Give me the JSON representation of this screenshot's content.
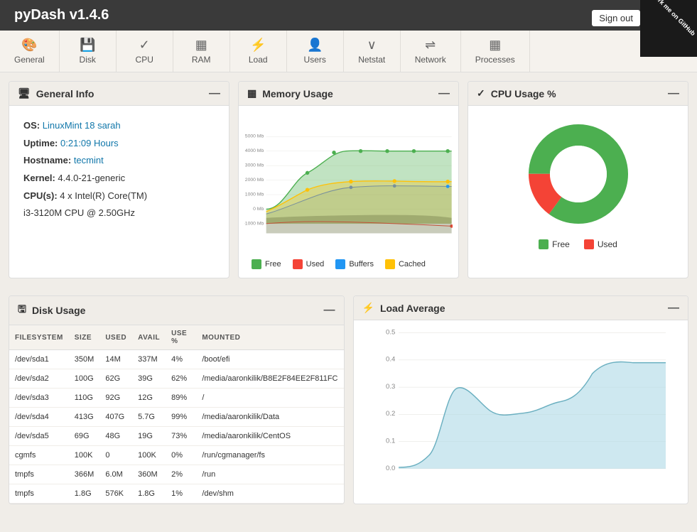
{
  "app": {
    "title": "pyDash v1.4.6",
    "sign_out_label": "Sign out",
    "github_label": "Fork me on GitHub"
  },
  "nav": {
    "items": [
      {
        "id": "general",
        "label": "General",
        "icon": "🎨"
      },
      {
        "id": "disk",
        "label": "Disk",
        "icon": "💾"
      },
      {
        "id": "cpu",
        "label": "CPU",
        "icon": "✓"
      },
      {
        "id": "ram",
        "label": "RAM",
        "icon": "▦"
      },
      {
        "id": "load",
        "label": "Load",
        "icon": "⚡"
      },
      {
        "id": "users",
        "label": "Users",
        "icon": "👤"
      },
      {
        "id": "netstat",
        "label": "Netstat",
        "icon": "∨"
      },
      {
        "id": "network",
        "label": "Network",
        "icon": "⇌"
      },
      {
        "id": "processes",
        "label": "Processes",
        "icon": "▦"
      }
    ]
  },
  "general_info": {
    "title": "General Info",
    "os_label": "OS:",
    "os_value": "LinuxMint 18 sarah",
    "uptime_label": "Uptime:",
    "uptime_value": "0:21:09 Hours",
    "hostname_label": "Hostname:",
    "hostname_value": "tecmint",
    "kernel_label": "Kernel:",
    "kernel_value": "4.4.0-21-generic",
    "cpu_label": "CPU(s):",
    "cpu_value": "4 x Intel(R) Core(TM)",
    "cpu_model": "i3-3120M CPU @ 2.50GHz"
  },
  "cpu_usage": {
    "title": "CPU Usage %",
    "free_pct": 85,
    "used_pct": 15,
    "free_label": "Free",
    "used_label": "Used",
    "free_color": "#4caf50",
    "used_color": "#f44336"
  },
  "memory_usage": {
    "title": "Memory Usage",
    "y_labels": [
      "5000 Mb",
      "4000 Mb",
      "3000 Mb",
      "2000 Mb",
      "1000 Mb",
      "0 Mb",
      "-1000 Mb"
    ],
    "legend": [
      {
        "label": "Free",
        "color": "#4caf50"
      },
      {
        "label": "Used",
        "color": "#f44336"
      },
      {
        "label": "Buffers",
        "color": "#2196f3"
      },
      {
        "label": "Cached",
        "color": "#ffc107"
      }
    ]
  },
  "disk_usage": {
    "title": "Disk Usage",
    "columns": [
      "FILESYSTEM",
      "SIZE",
      "USED",
      "AVAIL",
      "USE %",
      "MOUNTED"
    ],
    "rows": [
      [
        "/dev/sda1",
        "350M",
        "14M",
        "337M",
        "4%",
        "/boot/efi"
      ],
      [
        "/dev/sda2",
        "100G",
        "62G",
        "39G",
        "62%",
        "/media/aaronkilik/B8E2F84EE2F811FC"
      ],
      [
        "/dev/sda3",
        "110G",
        "92G",
        "12G",
        "89%",
        "/"
      ],
      [
        "/dev/sda4",
        "413G",
        "407G",
        "5.7G",
        "99%",
        "/media/aaronkilik/Data"
      ],
      [
        "/dev/sda5",
        "69G",
        "48G",
        "19G",
        "73%",
        "/media/aaronkilik/CentOS"
      ],
      [
        "cgmfs",
        "100K",
        "0",
        "100K",
        "0%",
        "/run/cgmanager/fs"
      ],
      [
        "tmpfs",
        "366M",
        "6.0M",
        "360M",
        "2%",
        "/run"
      ],
      [
        "tmpfs",
        "1.8G",
        "576K",
        "1.8G",
        "1%",
        "/dev/shm"
      ]
    ]
  },
  "load_average": {
    "title": "Load Average",
    "y_labels": [
      "0.5",
      "0.4",
      "0.3",
      "0.2",
      "0.1",
      "0.0"
    ]
  }
}
